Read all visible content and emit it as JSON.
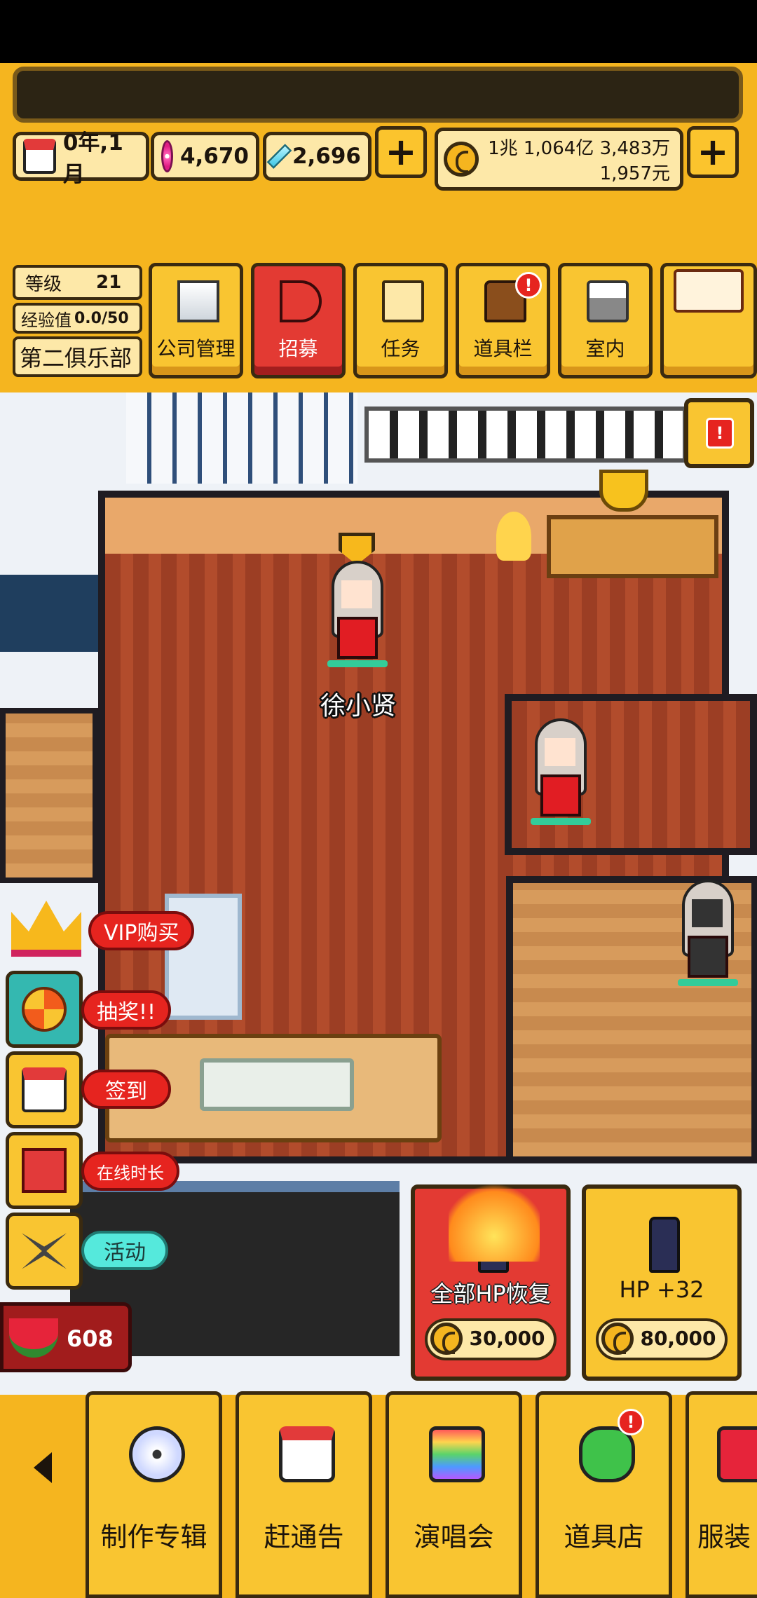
{
  "resources": {
    "date": "0年,1月",
    "pink_gems": "4,670",
    "blue_gems": "2,696",
    "money_line1": "1兆 1,064亿 3,483万",
    "money_line2": "1,957元",
    "plus_label": "+"
  },
  "level_panel": {
    "level_label": "等级",
    "level_value": "21",
    "exp_label": "经验值",
    "exp_value": "0.0/50",
    "club_name": "第二俱乐部"
  },
  "menu": [
    {
      "label": "公司管理",
      "icon": "building-icon"
    },
    {
      "label": "招募",
      "icon": "megaphone-icon",
      "active": true
    },
    {
      "label": "任务",
      "icon": "scroll-icon"
    },
    {
      "label": "道具栏",
      "icon": "chest-icon",
      "badge": "!"
    },
    {
      "label": "室内",
      "icon": "paint-roller-icon"
    },
    {
      "label": "",
      "icon": "mail-icon"
    }
  ],
  "scene": {
    "character_name": "徐小贤"
  },
  "side_menu": [
    {
      "label": "VIP购买",
      "icon": "crown-icon"
    },
    {
      "label": "抽奖!!",
      "icon": "roulette-icon"
    },
    {
      "label": "签到",
      "icon": "calendar-icon"
    },
    {
      "label": "在线时长",
      "icon": "gift-icon"
    },
    {
      "label": "活动",
      "icon": "butterfly-icon"
    }
  ],
  "watermelon": {
    "value": "608"
  },
  "hp_offers": [
    {
      "title": "全部HP恢复",
      "price": "30,000"
    },
    {
      "title": "HP +32",
      "price": "80,000"
    }
  ],
  "bottom_tabs": [
    {
      "label": "制作专辑",
      "icon": "disc-icon"
    },
    {
      "label": "赶通告",
      "icon": "calendar-icon"
    },
    {
      "label": "演唱会",
      "icon": "rainbow-stage-icon"
    },
    {
      "label": "道具店",
      "icon": "clover-icon",
      "badge": "!"
    },
    {
      "label": "服装",
      "icon": "shirt-icon"
    }
  ],
  "alert_badge": "!"
}
